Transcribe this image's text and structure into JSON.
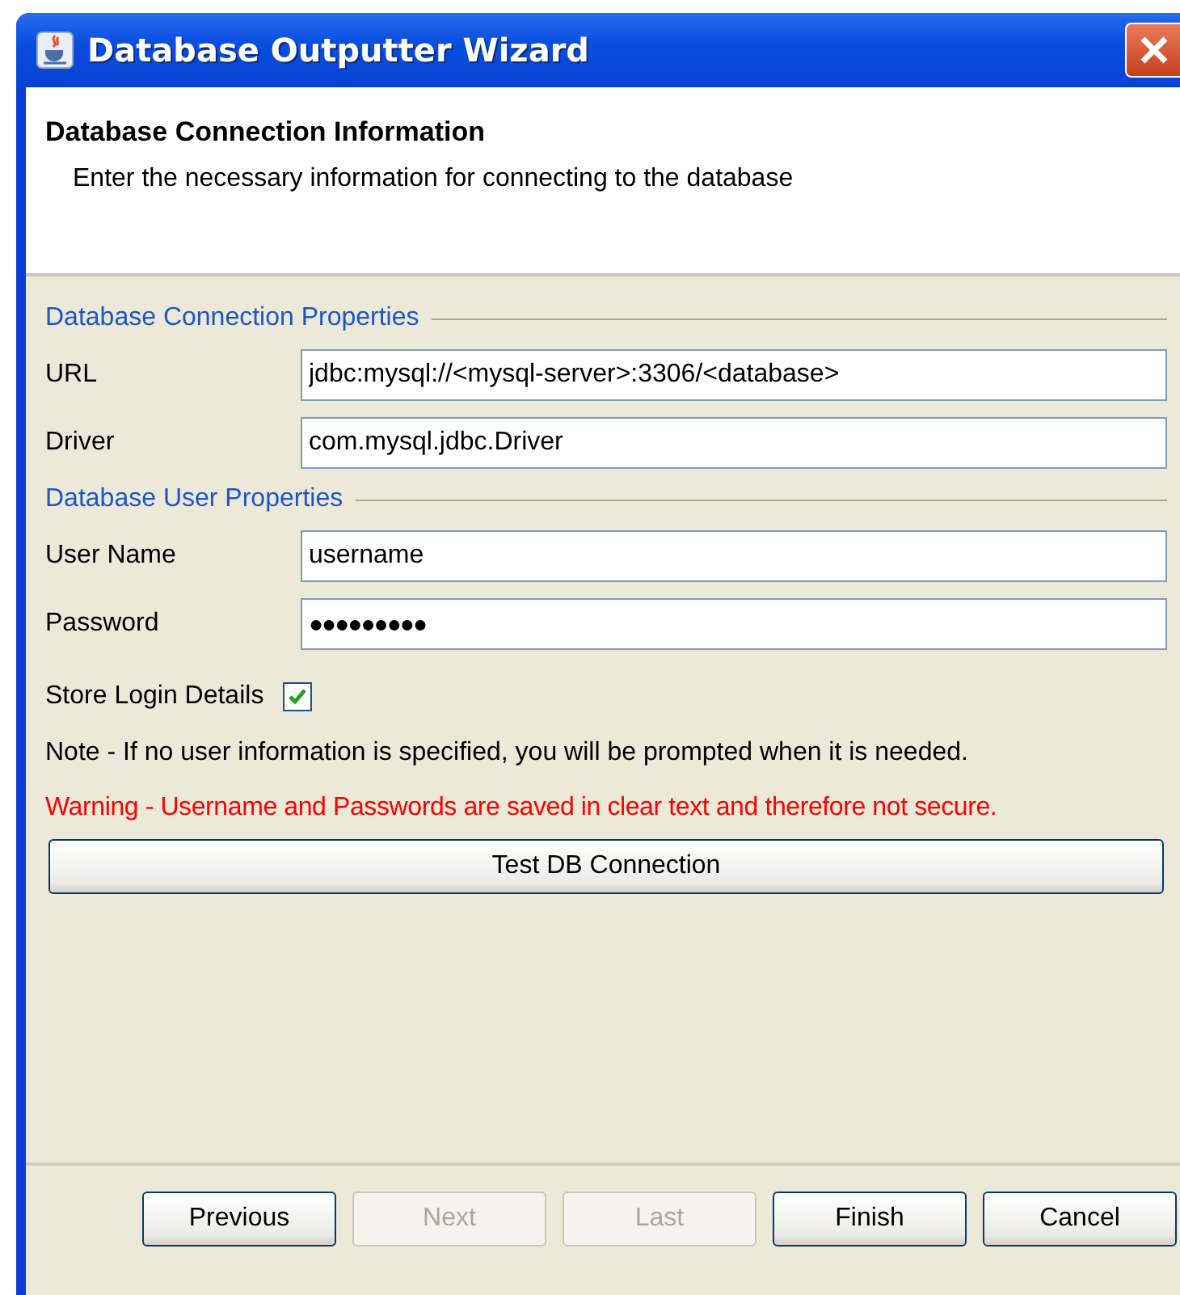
{
  "window": {
    "title": "Database Outputter Wizard"
  },
  "header": {
    "title": "Database Connection Information",
    "subtitle": "Enter the necessary information for connecting to the database"
  },
  "sections": [
    {
      "title": "Database Connection Properties",
      "fields": [
        {
          "label": "URL",
          "kind": "text",
          "value": "jdbc:mysql://<mysql-server>:3306/<database>"
        },
        {
          "label": "Driver",
          "kind": "text",
          "value": "com.mysql.jdbc.Driver"
        }
      ]
    },
    {
      "title": "Database User Properties",
      "fields": [
        {
          "label": "User Name",
          "kind": "text",
          "value": "username"
        },
        {
          "label": "Password",
          "kind": "password",
          "value": "●●●●●●●●●"
        }
      ]
    }
  ],
  "store_login": {
    "label": "Store Login Details",
    "checked": true
  },
  "note": "Note - If no user information is specified, you will be prompted when it is needed.",
  "warning": "Warning - Username and Passwords are saved in clear text and therefore not secure.",
  "test_button": "Test DB Connection",
  "buttons": [
    {
      "label": "Previous",
      "disabled": false
    },
    {
      "label": "Next",
      "disabled": true
    },
    {
      "label": "Last",
      "disabled": true
    },
    {
      "label": "Finish",
      "disabled": false
    },
    {
      "label": "Cancel",
      "disabled": false
    }
  ]
}
